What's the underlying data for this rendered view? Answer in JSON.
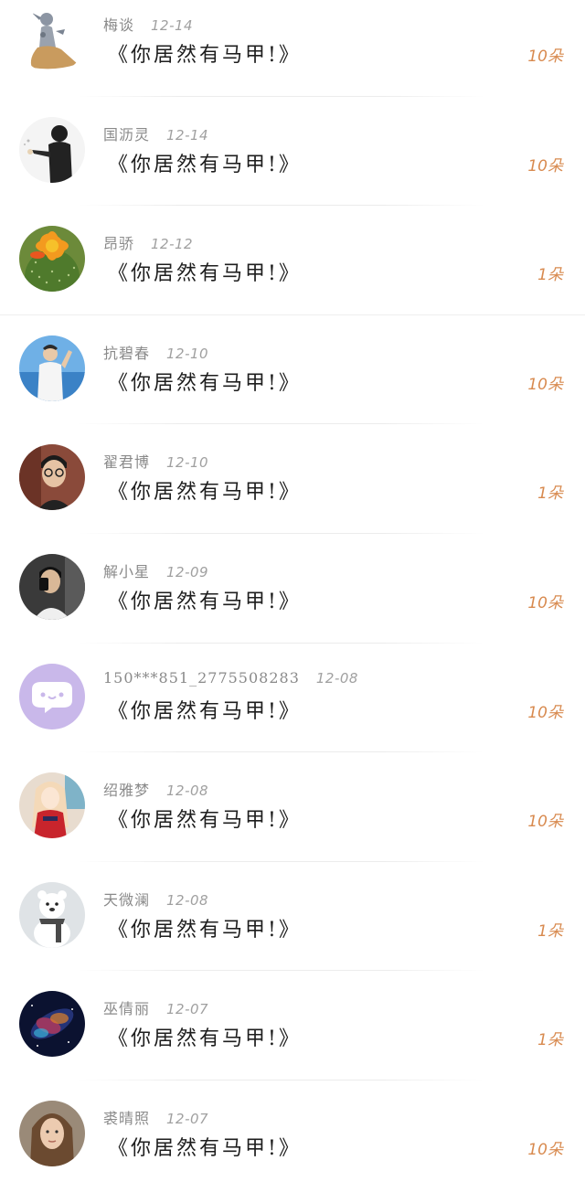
{
  "items": [
    {
      "name": "梅谈",
      "date": "12-14",
      "title": "《你居然有马甲!》",
      "amount": "10朵",
      "avatar": "cartoon-figure-avatar"
    },
    {
      "name": "国沥灵",
      "date": "12-14",
      "title": "《你居然有马甲!》",
      "amount": "10朵",
      "avatar": "person-in-black-avatar"
    },
    {
      "name": "昂骄",
      "date": "12-12",
      "title": "《你居然有马甲!》",
      "amount": "1朵",
      "avatar": "cactus-flower-avatar"
    },
    {
      "name": "抗碧春",
      "date": "12-10",
      "title": "《你居然有马甲!》",
      "amount": "10朵",
      "avatar": "man-by-sea-avatar"
    },
    {
      "name": "翟君博",
      "date": "12-10",
      "title": "《你居然有马甲!》",
      "amount": "1朵",
      "avatar": "man-with-glasses-avatar"
    },
    {
      "name": "解小星",
      "date": "12-09",
      "title": "《你居然有马甲!》",
      "amount": "10朵",
      "avatar": "mirror-selfie-avatar"
    },
    {
      "name": "150***851_2775508283",
      "date": "12-08",
      "title": "《你居然有马甲!》",
      "amount": "10朵",
      "avatar": "default-chat-bubble-avatar"
    },
    {
      "name": "绍雅梦",
      "date": "12-08",
      "title": "《你居然有马甲!》",
      "amount": "10朵",
      "avatar": "anime-girl-avatar"
    },
    {
      "name": "天微澜",
      "date": "12-08",
      "title": "《你居然有马甲!》",
      "amount": "1朵",
      "avatar": "snow-bear-avatar"
    },
    {
      "name": "巫倩丽",
      "date": "12-07",
      "title": "《你居然有马甲!》",
      "amount": "1朵",
      "avatar": "galaxy-avatar"
    },
    {
      "name": "裘晴照",
      "date": "12-07",
      "title": "《你居然有马甲!》",
      "amount": "10朵",
      "avatar": "woman-portrait-avatar"
    }
  ],
  "colors": {
    "amount": "#d88a4f",
    "name": "#8a8a8a",
    "title": "#1e1e1e",
    "default_avatar_bg": "#c9b8ea"
  }
}
